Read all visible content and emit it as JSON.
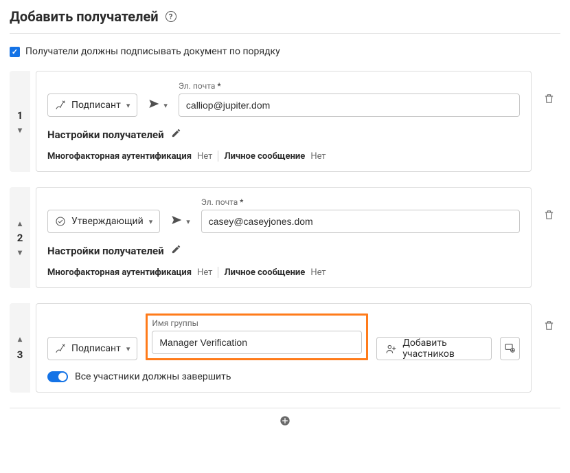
{
  "header": {
    "title": "Добавить получателей"
  },
  "orderCheckbox": {
    "label": "Получатели должны подписывать документ по порядку",
    "checked": true
  },
  "emailFieldLabel": "Эл. почта",
  "required": "*",
  "settingsLabel": "Настройки получателей",
  "meta": {
    "mfaLabel": "Многофакторная аутентификация",
    "mfaValue": "Нет",
    "msgLabel": "Личное сообщение",
    "msgValue": "Нет"
  },
  "recipients": [
    {
      "index": "1",
      "roleLabel": "Подписант",
      "email": "calliop@jupiter.dom"
    },
    {
      "index": "2",
      "roleLabel": "Утверждающий",
      "email": "casey@caseyjones.dom"
    }
  ],
  "group": {
    "index": "3",
    "roleLabel": "Подписант",
    "nameLabel": "Имя группы",
    "nameValue": "Manager Verification",
    "addMembersLabel": "Добавить участников",
    "allMustComplete": "Все участники должны завершить"
  }
}
